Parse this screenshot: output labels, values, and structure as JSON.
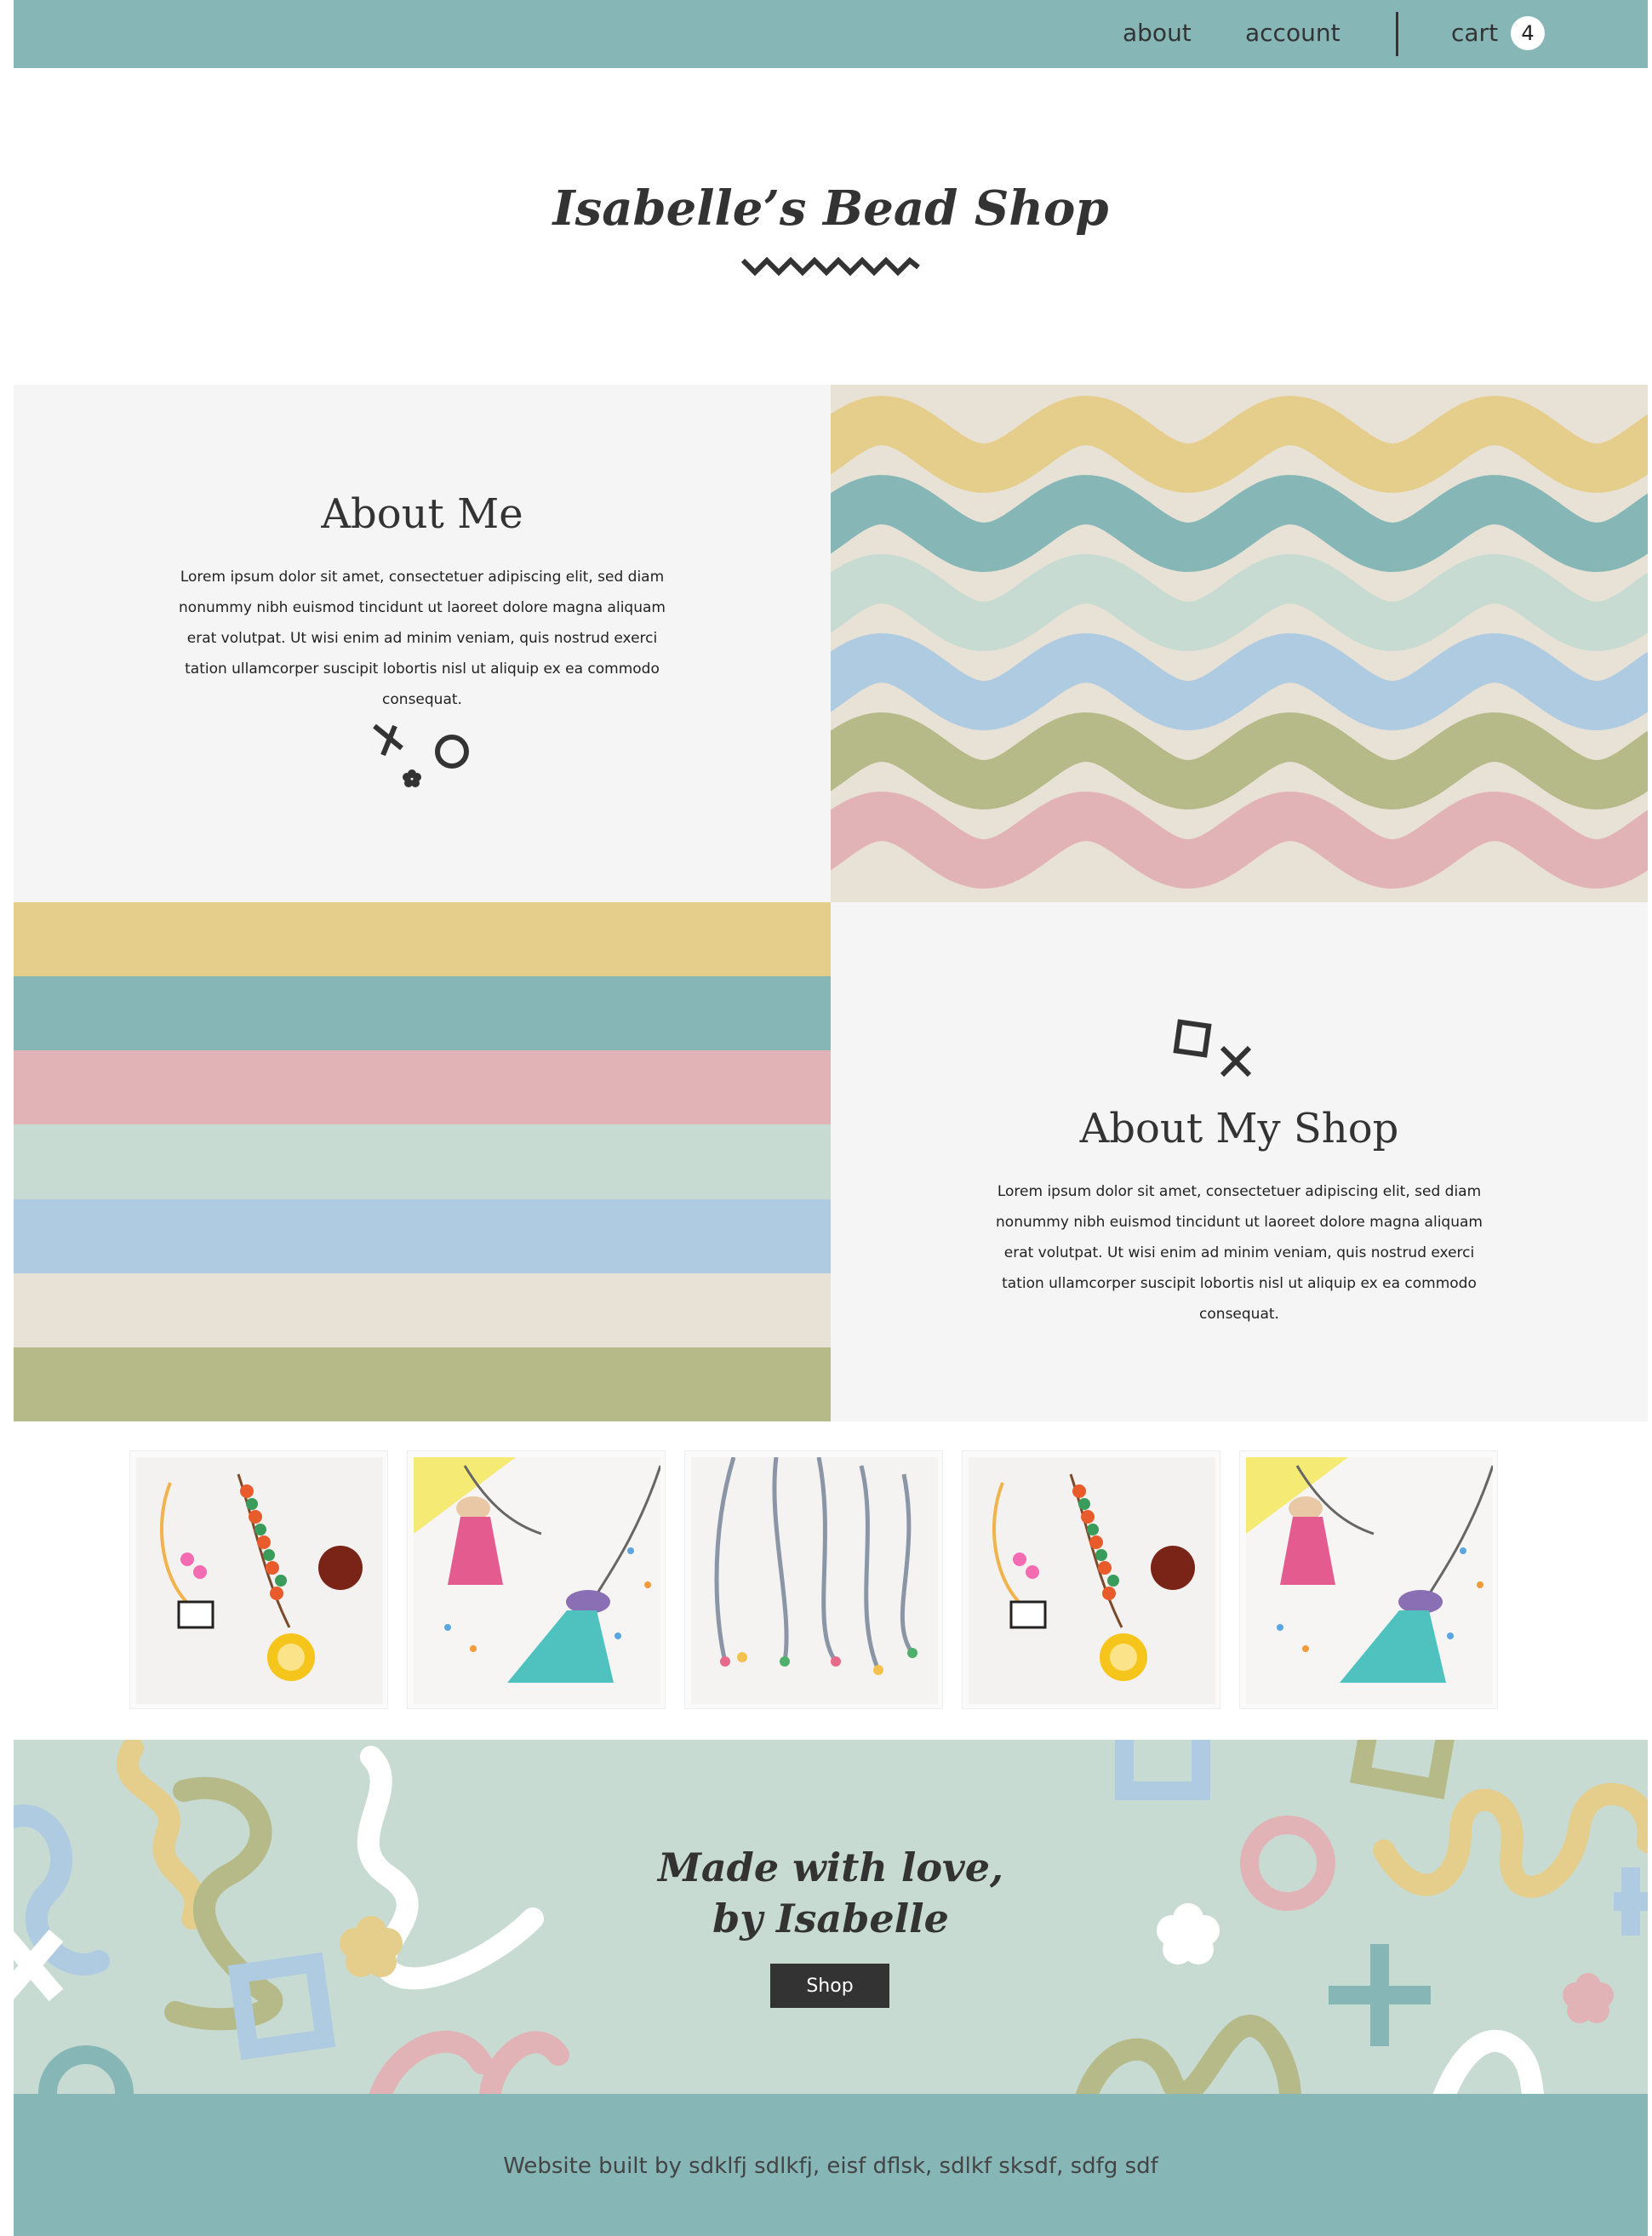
{
  "nav": {
    "about_label": "about",
    "account_label": "account",
    "cart_label": "cart",
    "cart_count": "4"
  },
  "header": {
    "title": "Isabelle’s Bead Shop"
  },
  "about_me": {
    "title": "About Me",
    "text": "Lorem ipsum dolor sit amet, consectetuer adipiscing elit, sed diam nonummy nibh euismod tincidunt ut laoreet dolore magna aliquam erat volutpat. Ut wisi enim ad minim veniam, quis nostrud exerci tation ullamcorper suscipit lobortis nisl ut aliquip ex ea commodo consequat."
  },
  "about_shop": {
    "title": "About My Shop",
    "text": "Lorem ipsum dolor sit amet, consectetuer adipiscing elit, sed diam nonummy nibh euismod tincidunt ut laoreet dolore magna aliquam erat volutpat. Ut wisi enim ad minim veniam, quis nostrud exerci tation ullamcorper suscipit lobortis nisl ut aliquip ex ea commodo consequat."
  },
  "palette": {
    "yellow": "#e5cd8c",
    "teal": "#86b6b6",
    "pink": "#e2b3b6",
    "mint": "#c8dbd3",
    "blue": "#aecbe1",
    "beige": "#e8e2d6",
    "olive": "#b5ba88"
  },
  "gallery": {
    "items": [
      "necklace-photo-lion-zebra",
      "necklace-photo-tassels",
      "necklace-photo-strings",
      "necklace-photo-lion-zebra",
      "necklace-photo-tassels"
    ]
  },
  "hero": {
    "line1": "Made with love,",
    "line2": "by Isabelle",
    "button_label": "Shop"
  },
  "footer": {
    "text": "Website built by sdklfj sdlkfj, eisf dflsk, sdlkf sksdf, sdfg sdf"
  }
}
